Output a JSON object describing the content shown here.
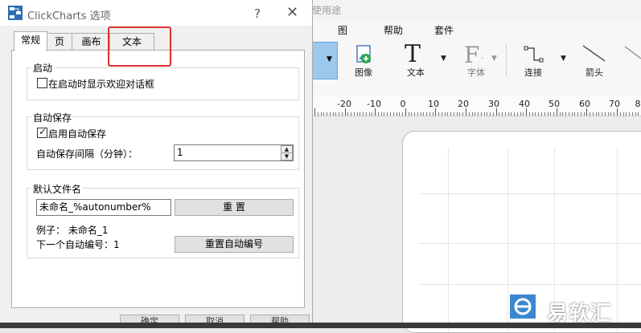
{
  "app": {
    "title_partial": "使用途",
    "menu": [
      "图",
      "帮助",
      "套件"
    ],
    "ribbon": {
      "image_label": "图像",
      "text_label": "文本",
      "font_label": "字体",
      "connect_label": "连接",
      "arrow_label": "箭头"
    },
    "ruler_labels": [
      "-20",
      "-10",
      "0",
      "10",
      "20",
      "30",
      "40",
      "50",
      "60",
      "70",
      "8"
    ]
  },
  "dialog": {
    "title": "ClickCharts 选项",
    "help_glyph": "?",
    "close_glyph": "✕",
    "tabs": [
      "常规",
      "页",
      "画布",
      "文本"
    ],
    "startup": {
      "title": "启动",
      "show_welcome_label": "在启动时显示欢迎对话框",
      "show_welcome_checked": false
    },
    "autosave": {
      "title": "自动保存",
      "enable_label": "启用自动保存",
      "enable_checked": true,
      "interval_label": "自动保存间隔（分钟）：",
      "interval_value": "1"
    },
    "default_filename": {
      "title": "默认文件名",
      "value": "未命名_%autonumber%",
      "reset_label": "重 置",
      "example_label": "例子：  未命名_1",
      "next_number_label": "下一个自动编号：1",
      "reset_autonumber_label": "重置自动编号"
    },
    "buttons": {
      "ok_partial": "确定",
      "cancel_partial": "取消",
      "help_partial": "帮助"
    }
  },
  "watermark": {
    "text": "易软汇"
  },
  "colors": {
    "highlight": "#e03030",
    "accent": "#1a73c8"
  }
}
